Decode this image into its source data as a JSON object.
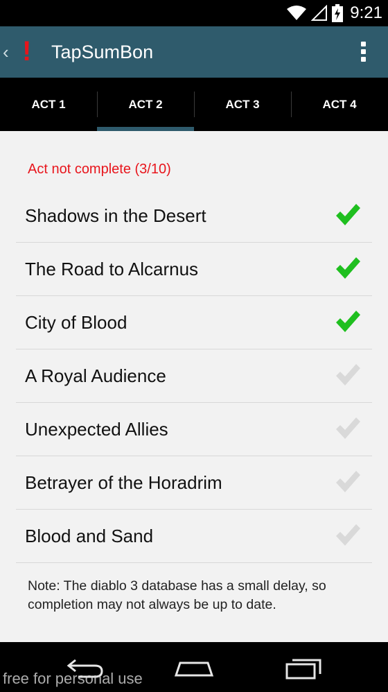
{
  "status_bar": {
    "time": "9:21"
  },
  "action_bar": {
    "title": "TapSumBon"
  },
  "tabs": [
    {
      "label": "ACT 1",
      "active": false
    },
    {
      "label": "ACT 2",
      "active": true
    },
    {
      "label": "ACT 3",
      "active": false
    },
    {
      "label": "ACT 4",
      "active": false
    }
  ],
  "act_status": "Act not complete (3/10)",
  "quests": [
    {
      "label": "Shadows in the Desert",
      "completed": true
    },
    {
      "label": "The Road to Alcarnus",
      "completed": true
    },
    {
      "label": "City of Blood",
      "completed": true
    },
    {
      "label": "A Royal Audience",
      "completed": false
    },
    {
      "label": "Unexpected Allies",
      "completed": false
    },
    {
      "label": "Betrayer of the Horadrim",
      "completed": false
    },
    {
      "label": "Blood and Sand",
      "completed": false
    }
  ],
  "note": "Note: The diablo 3 database has a small delay, so completion may not always be up to date.",
  "watermark": "free for personal use",
  "colors": {
    "action_bar": "#2f5b6c",
    "alert_red": "#e8151c",
    "check_complete": "#1fbf1f",
    "check_incomplete": "#d9d9d9"
  },
  "icons": {
    "wifi": "wifi-icon",
    "signal": "signal-icon",
    "battery": "battery-charging-icon",
    "app": "exclamation-icon",
    "overflow": "overflow-menu-icon",
    "check": "checkmark-icon",
    "back": "back-icon",
    "home": "home-icon",
    "recents": "recents-icon"
  }
}
